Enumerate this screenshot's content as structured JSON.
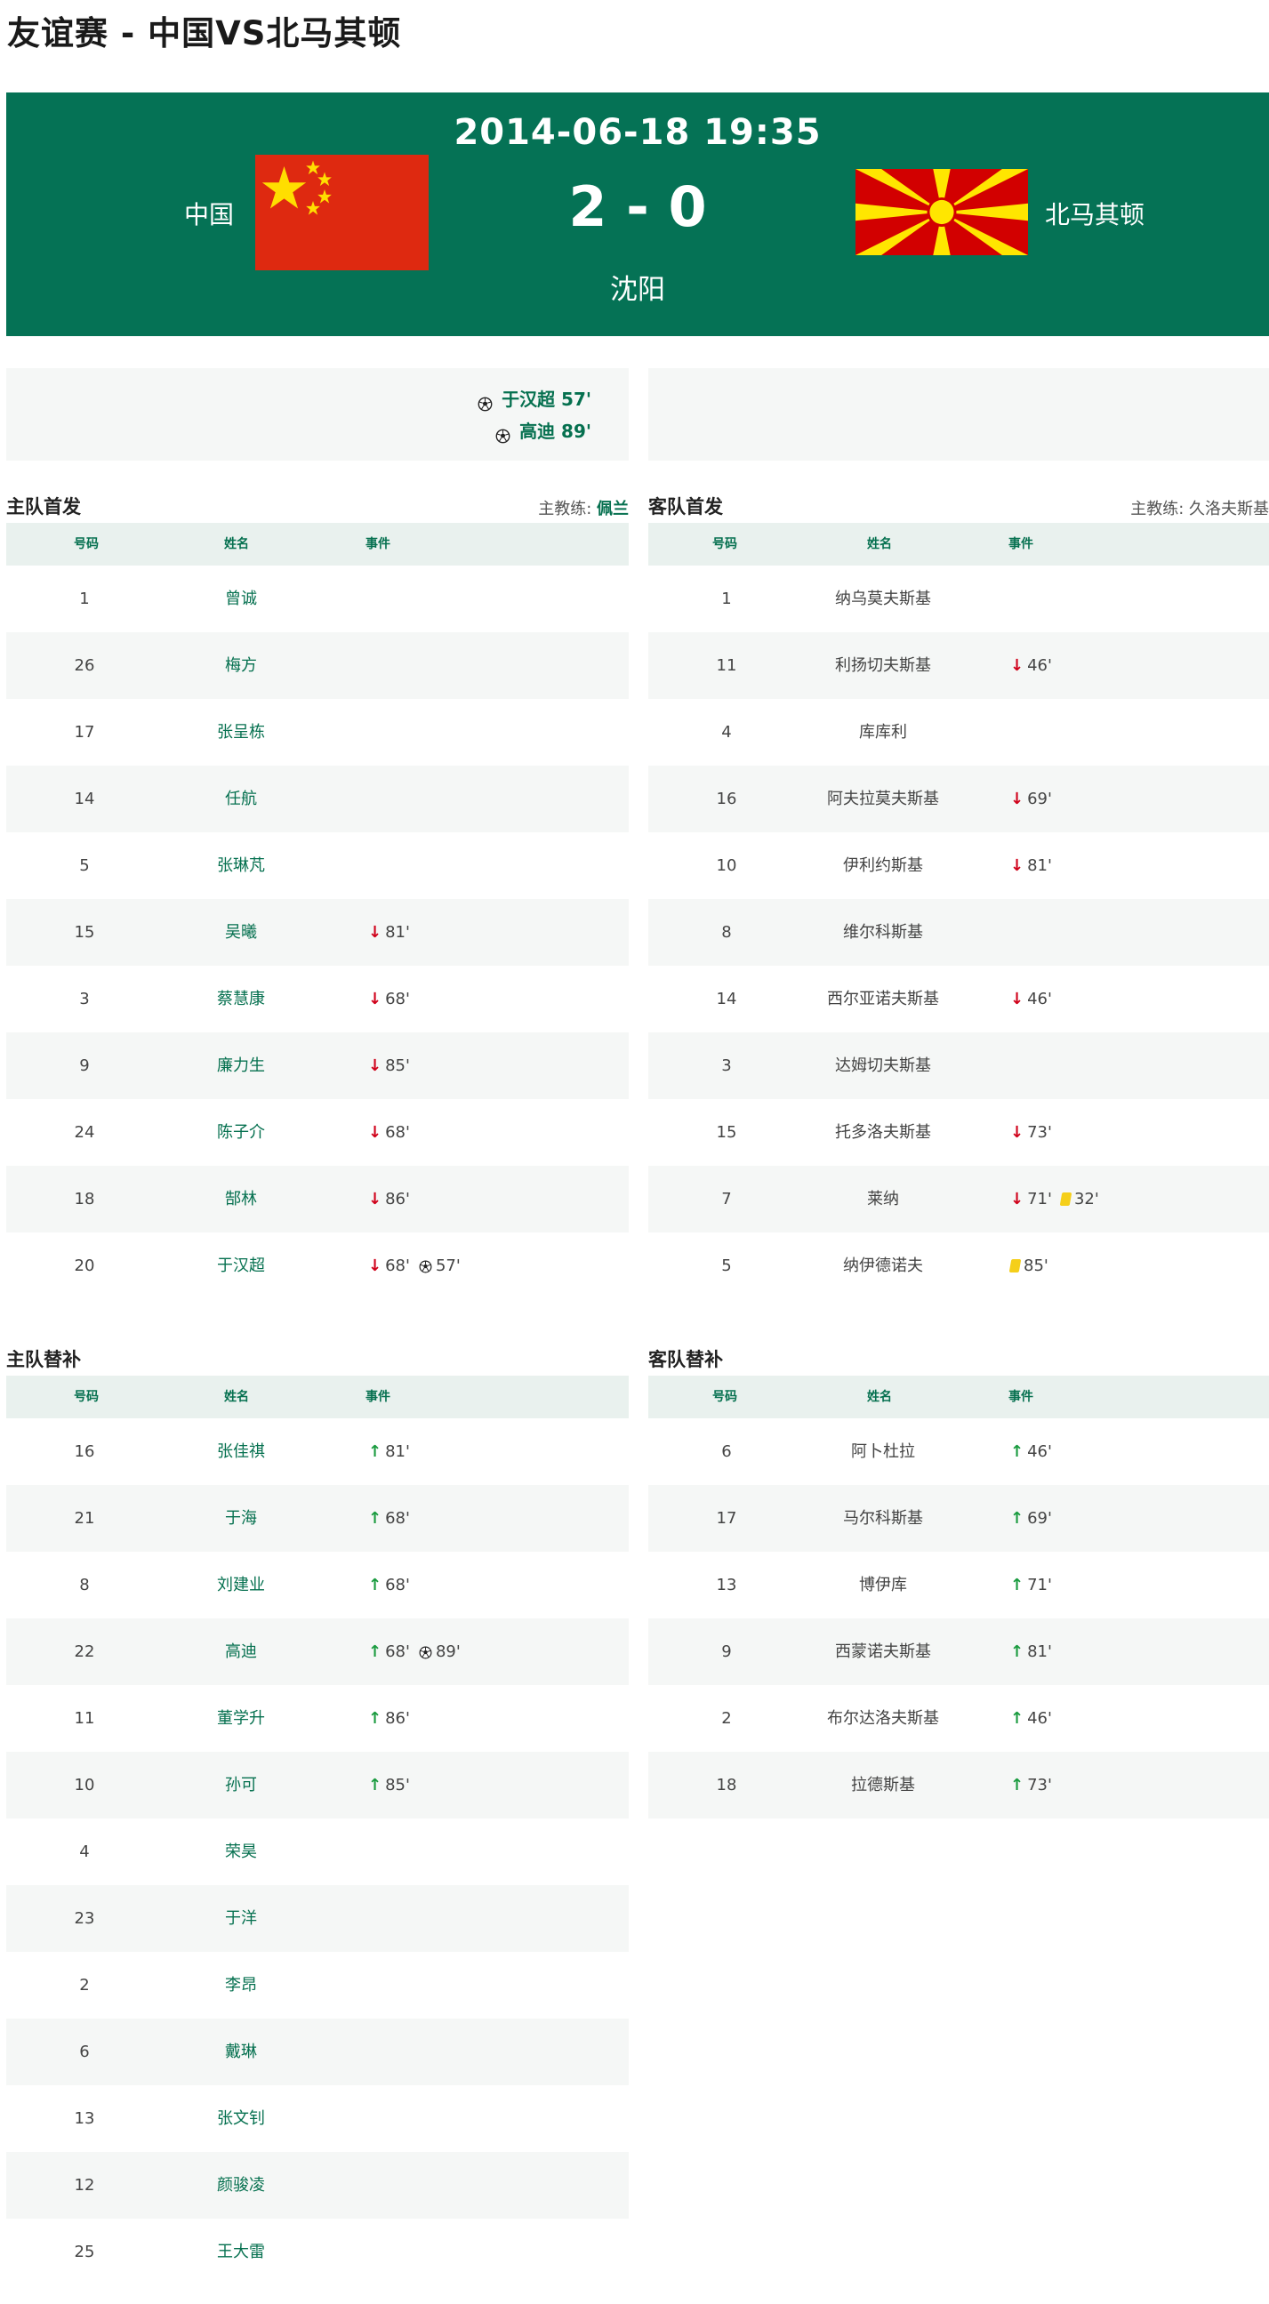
{
  "page": {
    "title": "友谊赛  -  中国VS北马其顿"
  },
  "match": {
    "datetime": "2014-06-18 19:35",
    "score": "2 - 0",
    "venue": "沈阳",
    "home_team": "中国",
    "away_team": "北马其顿",
    "home_flag": "china-flag",
    "away_flag": "north-macedonia-flag"
  },
  "colors": {
    "accent": "#057255",
    "out": "#d0021b",
    "in": "#1a9b3f",
    "yellow_card": "#f5cf1a"
  },
  "goals": {
    "home": [
      {
        "icon": "soccer-ball-icon",
        "text": "于汉超 57'"
      },
      {
        "icon": "soccer-ball-icon",
        "text": "高迪 89'"
      }
    ],
    "away": []
  },
  "columns": {
    "number": "号码",
    "name": "姓名",
    "events": "事件"
  },
  "home_starting": {
    "title": "主队首发",
    "coach_label": "主教练: ",
    "coach_name": "佩兰",
    "players": [
      {
        "num": "1",
        "name": "曾诚",
        "events": []
      },
      {
        "num": "26",
        "name": "梅方",
        "events": []
      },
      {
        "num": "17",
        "name": "张呈栋",
        "events": []
      },
      {
        "num": "14",
        "name": "任航",
        "events": []
      },
      {
        "num": "5",
        "name": "张琳芃",
        "events": []
      },
      {
        "num": "15",
        "name": "吴曦",
        "events": [
          {
            "type": "out",
            "minute": "81'"
          }
        ]
      },
      {
        "num": "3",
        "name": "蔡慧康",
        "events": [
          {
            "type": "out",
            "minute": "68'"
          }
        ]
      },
      {
        "num": "9",
        "name": "廉力生",
        "events": [
          {
            "type": "out",
            "minute": "85'"
          }
        ]
      },
      {
        "num": "24",
        "name": "陈子介",
        "events": [
          {
            "type": "out",
            "minute": "68'"
          }
        ]
      },
      {
        "num": "18",
        "name": "郜林",
        "events": [
          {
            "type": "out",
            "minute": "86'"
          }
        ]
      },
      {
        "num": "20",
        "name": "于汉超",
        "events": [
          {
            "type": "out",
            "minute": "68'"
          },
          {
            "type": "goal",
            "minute": "57'"
          }
        ]
      }
    ]
  },
  "away_starting": {
    "title": "客队首发",
    "coach_label": "主教练: ",
    "coach_name": "久洛夫斯基",
    "players": [
      {
        "num": "1",
        "name": "纳乌莫夫斯基",
        "events": []
      },
      {
        "num": "11",
        "name": "利扬切夫斯基",
        "events": [
          {
            "type": "out",
            "minute": "46'"
          }
        ]
      },
      {
        "num": "4",
        "name": "库库利",
        "events": []
      },
      {
        "num": "16",
        "name": "阿夫拉莫夫斯基",
        "events": [
          {
            "type": "out",
            "minute": "69'"
          }
        ]
      },
      {
        "num": "10",
        "name": "伊利约斯基",
        "events": [
          {
            "type": "out",
            "minute": "81'"
          }
        ]
      },
      {
        "num": "8",
        "name": "维尔科斯基",
        "events": []
      },
      {
        "num": "14",
        "name": "西尔亚诺夫斯基",
        "events": [
          {
            "type": "out",
            "minute": "46'"
          }
        ]
      },
      {
        "num": "3",
        "name": "达姆切夫斯基",
        "events": []
      },
      {
        "num": "15",
        "name": "托多洛夫斯基",
        "events": [
          {
            "type": "out",
            "minute": "73'"
          }
        ]
      },
      {
        "num": "7",
        "name": "莱纳",
        "events": [
          {
            "type": "out",
            "minute": "71'"
          },
          {
            "type": "yellow",
            "minute": "32'"
          }
        ]
      },
      {
        "num": "5",
        "name": "纳伊德诺夫",
        "events": [
          {
            "type": "yellow",
            "minute": "85'"
          }
        ]
      }
    ]
  },
  "home_subs": {
    "title": "主队替补",
    "players": [
      {
        "num": "16",
        "name": "张佳祺",
        "events": [
          {
            "type": "in",
            "minute": "81'"
          }
        ]
      },
      {
        "num": "21",
        "name": "于海",
        "events": [
          {
            "type": "in",
            "minute": "68'"
          }
        ]
      },
      {
        "num": "8",
        "name": "刘建业",
        "events": [
          {
            "type": "in",
            "minute": "68'"
          }
        ]
      },
      {
        "num": "22",
        "name": "高迪",
        "events": [
          {
            "type": "in",
            "minute": "68'"
          },
          {
            "type": "goal",
            "minute": "89'"
          }
        ]
      },
      {
        "num": "11",
        "name": "董学升",
        "events": [
          {
            "type": "in",
            "minute": "86'"
          }
        ]
      },
      {
        "num": "10",
        "name": "孙可",
        "events": [
          {
            "type": "in",
            "minute": "85'"
          }
        ]
      },
      {
        "num": "4",
        "name": "荣昊",
        "events": []
      },
      {
        "num": "23",
        "name": "于洋",
        "events": []
      },
      {
        "num": "2",
        "name": "李昂",
        "events": []
      },
      {
        "num": "6",
        "name": "戴琳",
        "events": []
      },
      {
        "num": "13",
        "name": "张文钊",
        "events": []
      },
      {
        "num": "12",
        "name": "颜骏凌",
        "events": []
      },
      {
        "num": "25",
        "name": "王大雷",
        "events": []
      }
    ]
  },
  "away_subs": {
    "title": "客队替补",
    "players": [
      {
        "num": "6",
        "name": "阿卜杜拉",
        "events": [
          {
            "type": "in",
            "minute": "46'"
          }
        ]
      },
      {
        "num": "17",
        "name": "马尔科斯基",
        "events": [
          {
            "type": "in",
            "minute": "69'"
          }
        ]
      },
      {
        "num": "13",
        "name": "博伊库",
        "events": [
          {
            "type": "in",
            "minute": "71'"
          }
        ]
      },
      {
        "num": "9",
        "name": "西蒙诺夫斯基",
        "events": [
          {
            "type": "in",
            "minute": "81'"
          }
        ]
      },
      {
        "num": "2",
        "name": "布尔达洛夫斯基",
        "events": [
          {
            "type": "in",
            "minute": "46'"
          }
        ]
      },
      {
        "num": "18",
        "name": "拉德斯基",
        "events": [
          {
            "type": "in",
            "minute": "73'"
          }
        ]
      }
    ]
  }
}
